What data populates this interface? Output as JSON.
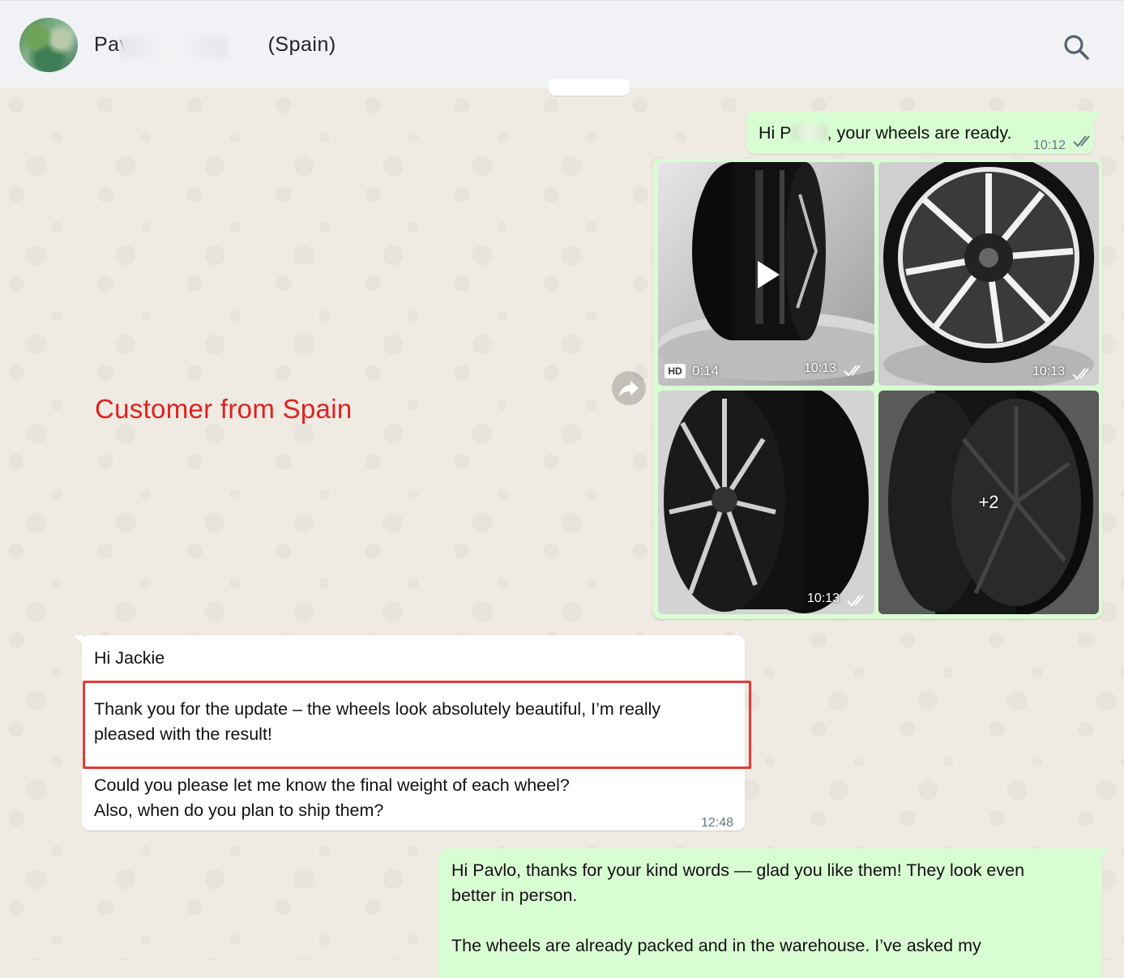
{
  "header": {
    "contact_name_prefix": "Pav",
    "contact_name_suffix": "(Spain)",
    "icons": {
      "search": "search-icon",
      "avatar": "avatar"
    }
  },
  "annotation": {
    "text": "Customer from Spain",
    "color": "#e02020"
  },
  "messages": {
    "greeting_out": {
      "prefix": "Hi P",
      "suffix": ", your wheels are ready.",
      "time": "10:12"
    },
    "media": {
      "video": {
        "badge": "HD",
        "duration": "0:14",
        "time": "10:13"
      },
      "photo_front": {
        "time": "10:13"
      },
      "photo_side": {
        "time": "10:13"
      },
      "photo_more": {
        "more_label": "+2"
      }
    },
    "reply_in": {
      "line1": "Hi Jackie",
      "line2": "Thank you for the update – the wheels look absolutely beautiful, I’m really",
      "line3": "pleased with the result!",
      "line4": "Could you please let me know the final weight of each wheel?",
      "line5": "Also, when do you plan to ship them?",
      "time": "12:48"
    },
    "answer_out": {
      "line1": "Hi Pavlo, thanks for your kind words — glad you like them! They look even",
      "line2": "better in person.",
      "line3": "The wheels are already packed and in the warehouse. I’ve asked my"
    }
  },
  "colors": {
    "outgoing_bubble": "#d9fdd3",
    "incoming_bubble": "#ffffff",
    "chat_background": "#efeae2",
    "header_background": "#f0f2f5",
    "read_ticks": "#667781",
    "highlight_border": "#e53935"
  }
}
